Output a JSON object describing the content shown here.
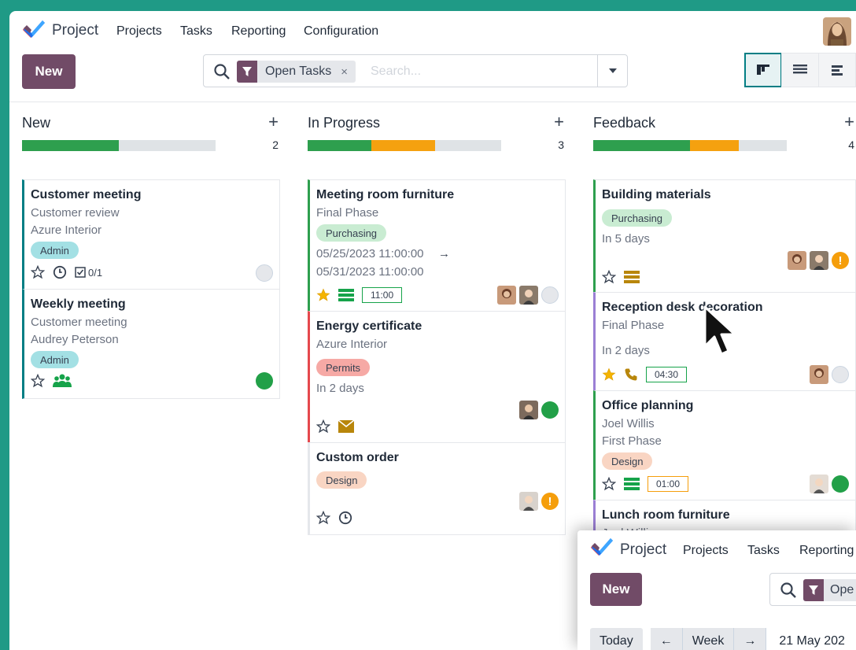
{
  "app": {
    "brand": "Project",
    "menu": [
      "Projects",
      "Tasks",
      "Reporting",
      "Configuration"
    ]
  },
  "toolbar": {
    "new_label": "New",
    "filter_facet": "Open Tasks",
    "facet_remove": "×",
    "search_placeholder": "Search..."
  },
  "columns": [
    {
      "title": "New",
      "count": "2",
      "progress": {
        "green": 0.5,
        "orange": 0,
        "grey": 0.5
      },
      "cards": [
        {
          "title": "Customer meeting",
          "lines": [
            "Customer review",
            "Azure Interior"
          ],
          "tag": "Admin",
          "subtasks": "0/1",
          "state": "normal"
        },
        {
          "title": "Weekly meeting",
          "lines": [
            "Customer meeting",
            "Audrey Peterson"
          ],
          "tag": "Admin",
          "state": "done"
        }
      ]
    },
    {
      "title": "In Progress",
      "count": "3",
      "progress": {
        "green": 0.33,
        "orange": 0.33,
        "grey": 0.34
      },
      "cards": [
        {
          "title": "Meeting room furniture",
          "lines": [
            "Final Phase"
          ],
          "tag": "Purchasing",
          "dates": [
            "05/25/2023 11:00:00",
            "→",
            "05/31/2023 11:00:00"
          ],
          "time": "11:00",
          "starred": true,
          "state": "normal"
        },
        {
          "title": "Energy certificate",
          "lines": [
            "Azure Interior"
          ],
          "tag": "Permits",
          "deadline": "In 2 days",
          "state": "done"
        },
        {
          "title": "Custom order",
          "lines": [],
          "tag": "Design",
          "state": "blocked"
        }
      ]
    },
    {
      "title": "Feedback",
      "count": "4",
      "progress": {
        "green": 0.5,
        "orange": 0.25,
        "grey": 0.25
      },
      "cards": [
        {
          "title": "Building materials",
          "lines": [],
          "tag": "Purchasing",
          "deadline": "In 5 days",
          "state": "blocked"
        },
        {
          "title": "Reception desk decoration",
          "lines": [
            "Final Phase"
          ],
          "deadline": "In 2 days",
          "time": "04:30",
          "starred": true,
          "state": "normal"
        },
        {
          "title": "Office planning",
          "lines": [
            "Joel Willis",
            "First Phase"
          ],
          "tag": "Design",
          "time": "01:00",
          "state": "done"
        },
        {
          "title": "Lunch room furniture",
          "lines": [
            "Joel Willis"
          ]
        }
      ]
    }
  ],
  "overlay": {
    "brand": "Project",
    "menu": [
      "Projects",
      "Tasks",
      "Reporting"
    ],
    "new_label": "New",
    "facet_partial": "Ope",
    "today": "Today",
    "prev": "←",
    "scale": "Week",
    "next": "→",
    "date": "21 May 202"
  },
  "colors": {
    "primary": "#714b67",
    "accent": "#017e84",
    "green": "#22a048",
    "orange": "#f59e0b",
    "red": "#e5484d",
    "purple": "#9b7fd4"
  }
}
